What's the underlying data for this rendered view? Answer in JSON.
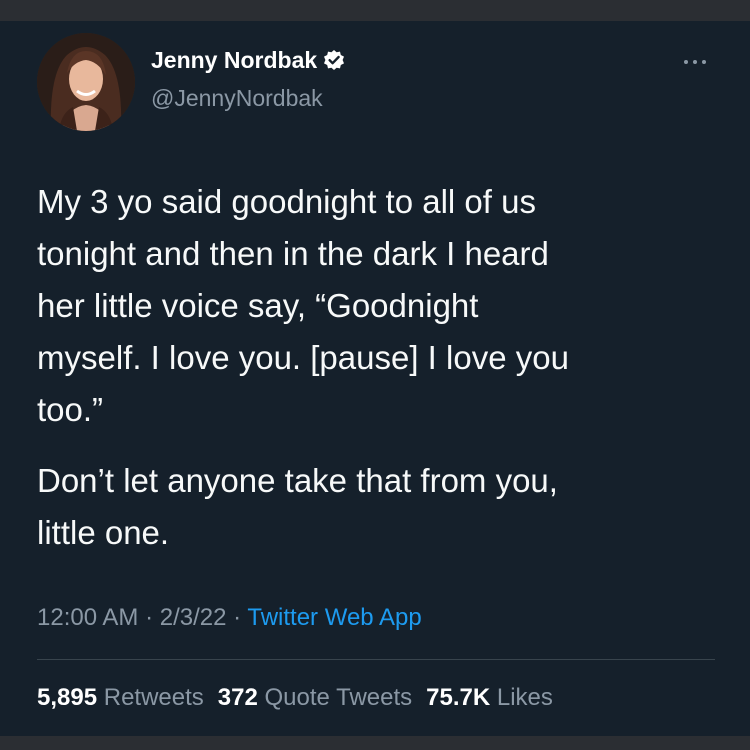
{
  "author": {
    "display_name": "Jenny Nordbak",
    "handle": "@JennyNordbak",
    "verified": true
  },
  "tweet": {
    "paragraphs": [
      "My 3 yo said goodnight to all of us\ntonight and then in the dark I heard\nher little voice say, “Goodnight\nmyself. I love you. [pause] I love you\ntoo.”",
      "Don’t let anyone take that from you,\nlittle one."
    ]
  },
  "meta": {
    "time": "12:00 AM",
    "separator": " · ",
    "date": "2/3/22",
    "source": "Twitter Web App"
  },
  "stats": {
    "retweets": {
      "count": "5,895",
      "label": "Retweets"
    },
    "quotes": {
      "count": "372",
      "label": "Quote Tweets"
    },
    "likes": {
      "count": "75.7K",
      "label": "Likes"
    }
  },
  "icons": {
    "verified": "verified-badge-icon",
    "more": "more-options-icon"
  },
  "colors": {
    "background": "#15202b",
    "text": "#f7f9f9",
    "secondary": "#8b98a5",
    "link": "#1d9bf0"
  }
}
